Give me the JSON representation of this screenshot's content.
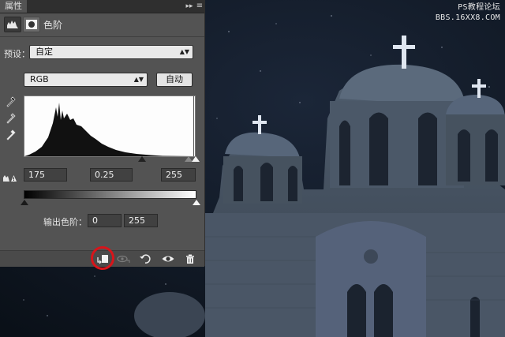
{
  "watermark": {
    "line1": "PS教程论坛",
    "line2": "BBS.16XX8.COM"
  },
  "panel": {
    "tab_label": "属性",
    "collapse_glyph": "▸▸",
    "menu_glyph": "≡",
    "adjustment_name": "色阶",
    "header_icons": [
      "levels-icon",
      "mask-icon"
    ]
  },
  "preset": {
    "label": "预设：",
    "value": "自定"
  },
  "channel": {
    "value": "RGB",
    "auto_button": "自动"
  },
  "eyedroppers": [
    "black-point-eyedropper-icon",
    "gray-point-eyedropper-icon",
    "white-point-eyedropper-icon"
  ],
  "input_levels": {
    "black": "175",
    "gamma": "0.25",
    "white": "255"
  },
  "output_levels": {
    "label": "输出色阶：",
    "black": "0",
    "white": "255"
  },
  "bottom_toolbar": [
    "clip-to-layer-icon",
    "view-previous-state-icon",
    "reset-icon",
    "visibility-eye-icon",
    "delete-icon"
  ],
  "colors": {
    "panel": "#535353",
    "sky": "#0d1420",
    "highlight_ring": "#d8141a"
  }
}
